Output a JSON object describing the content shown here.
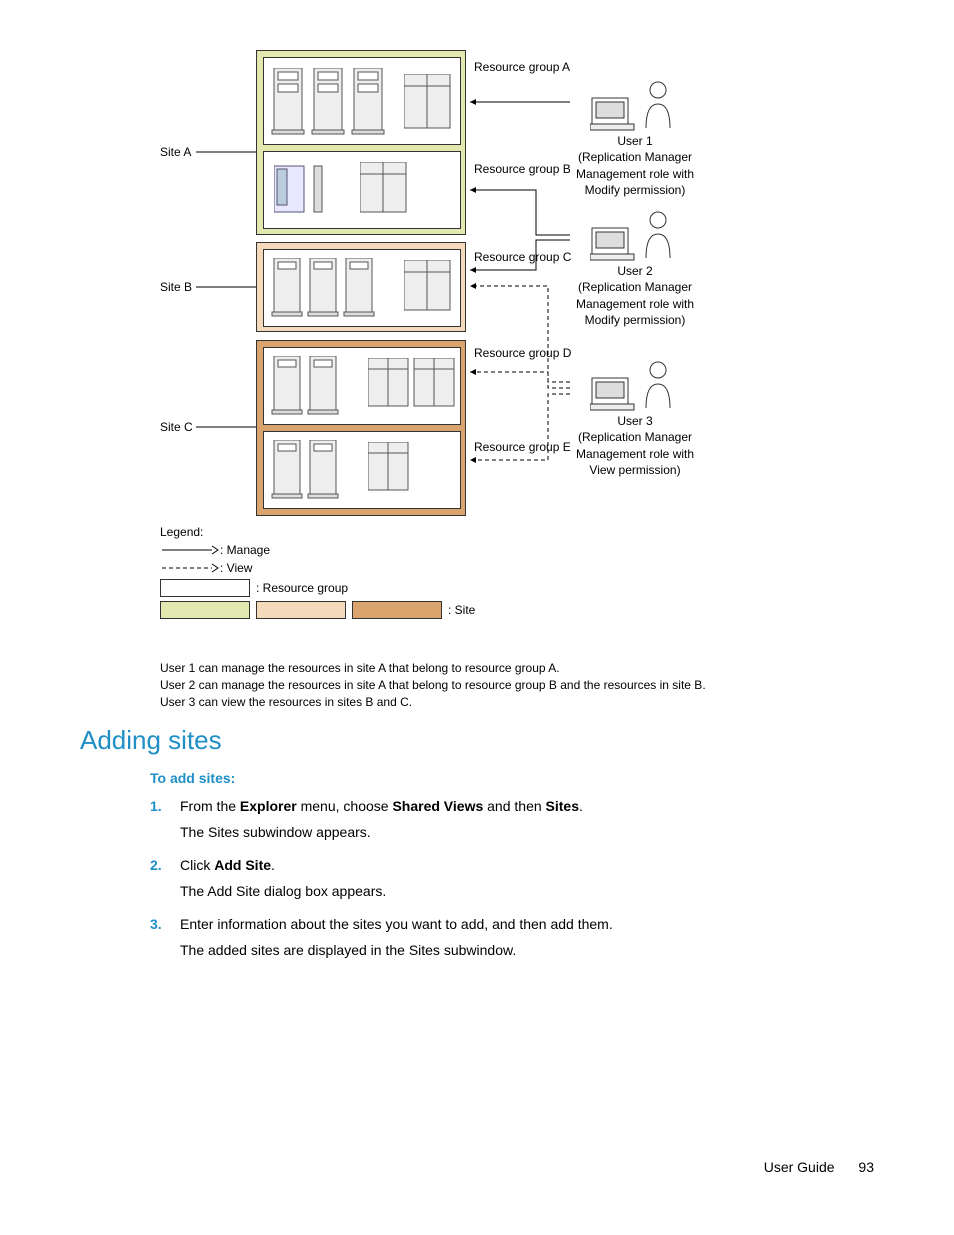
{
  "diagram": {
    "sites": {
      "siteA": {
        "label": "Site A",
        "groups": [
          "Resource group A",
          "Resource group B"
        ]
      },
      "siteB": {
        "label": "Site B",
        "groups": [
          "Resource group C"
        ]
      },
      "siteC": {
        "label": "Site C",
        "groups": [
          "Resource group D",
          "Resource group E"
        ]
      }
    },
    "users": {
      "u1": {
        "name": "User 1",
        "role_l1": "(Replication Manager",
        "role_l2": "Management role with",
        "role_l3": "Modify permission)"
      },
      "u2": {
        "name": "User 2",
        "role_l1": "(Replication Manager",
        "role_l2": "Management role with",
        "role_l3": "Modify permission)"
      },
      "u3": {
        "name": "User 3",
        "role_l1": "(Replication Manager",
        "role_l2": "Management role with",
        "role_l3": "View permission)"
      }
    },
    "legend": {
      "title": "Legend:",
      "manage": ": Manage",
      "view": ": View",
      "rg": ": Resource group",
      "site": ": Site"
    },
    "notes": {
      "n1": "User 1 can manage the resources in site A that belong to resource group A.",
      "n2": "User 2 can manage the resources in site A that belong to resource group B and the resources in site B.",
      "n3": "User 3 can view the resources in sites B and C."
    }
  },
  "section": {
    "heading": "Adding sites",
    "subheading": "To add sites:",
    "steps": [
      {
        "num": "1.",
        "line": "From the Explorer menu, choose Shared Views and then Sites.",
        "sub": "The Sites subwindow appears."
      },
      {
        "num": "2.",
        "line": "Click Add Site.",
        "sub": "The Add Site dialog box appears."
      },
      {
        "num": "3.",
        "line": "Enter information about the sites you want to add, and then add them.",
        "sub": "The added sites are displayed in the Sites subwindow."
      }
    ]
  },
  "footer": {
    "label": "User Guide",
    "page": "93"
  }
}
